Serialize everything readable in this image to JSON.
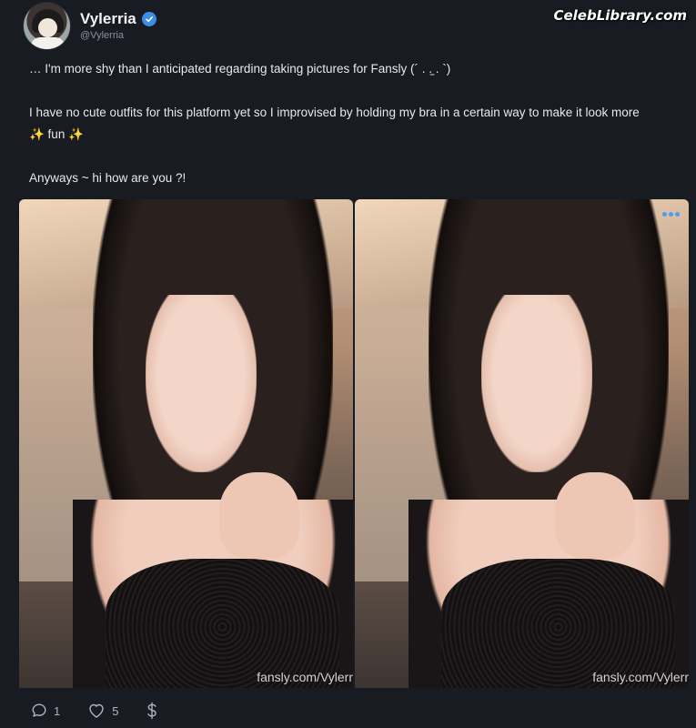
{
  "header": {
    "display_name": "Vylerria",
    "handle": "@Vylerria",
    "verified": true,
    "avatar_icon": "avatar-image"
  },
  "watermark": {
    "text": "CelebLibrary.com"
  },
  "post": {
    "lines": [
      "… I'm more shy than I anticipated regarding taking pictures for Fansly (´ . .̫ . `)",
      "I have no cute outfits for this platform yet so I improvised by holding my bra in a certain way to make it look more",
      "✨ fun ✨",
      "Anyways ~ hi how are you ?!"
    ]
  },
  "media": [
    {
      "credit": "fansly.com/Vylerr"
    },
    {
      "credit": "fansly.com/Vylerr",
      "more_icon": "ellipsis-icon"
    }
  ],
  "actions": {
    "comments": {
      "icon": "comment-icon",
      "count": "1"
    },
    "likes": {
      "icon": "heart-icon",
      "count": "5"
    },
    "tip": {
      "icon": "dollar-icon"
    }
  },
  "colors": {
    "background": "#181b22",
    "accent": "#3b8ee8",
    "muted": "#8c909a"
  }
}
